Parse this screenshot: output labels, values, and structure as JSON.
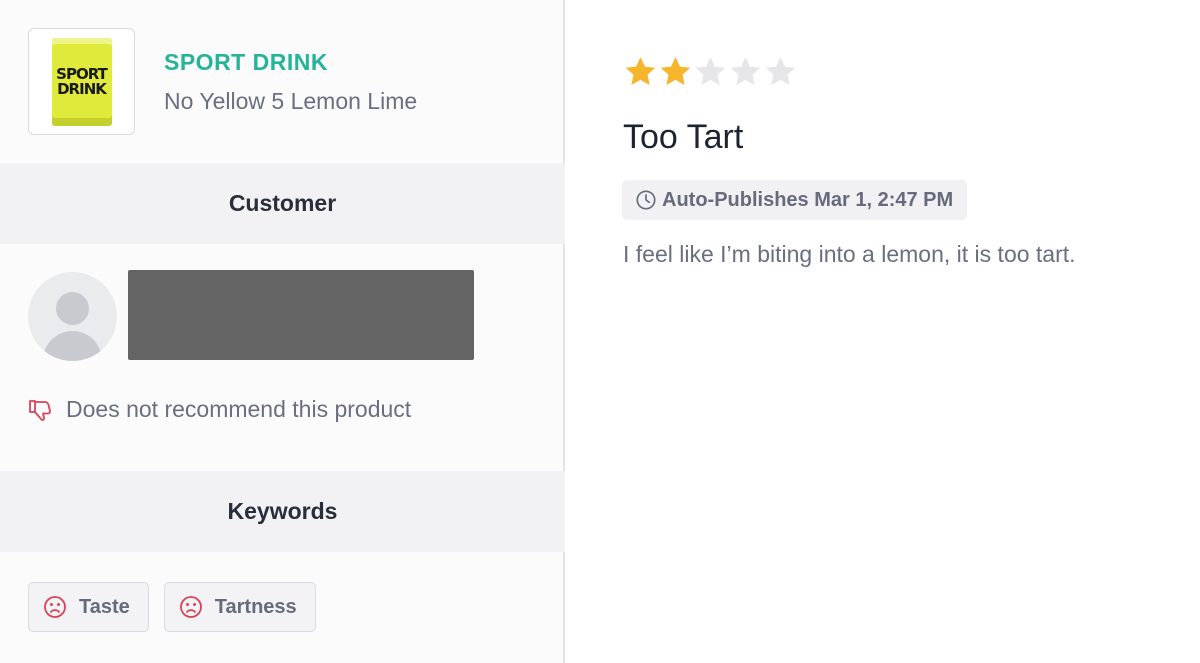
{
  "product": {
    "brand": "SPORT DRINK",
    "name": "No Yellow 5 Lemon Lime",
    "can_text_line1": "SPORT",
    "can_text_line2": "DRINK"
  },
  "customer": {
    "section_title": "Customer",
    "recommendation": "Does not recommend this product"
  },
  "keywords": {
    "section_title": "Keywords",
    "items": [
      {
        "label": "Taste",
        "icon": "frown-icon"
      },
      {
        "label": "Tartness",
        "icon": "frown-icon"
      }
    ]
  },
  "review": {
    "rating": 2,
    "max_rating": 5,
    "title": "Too Tart",
    "publish_status": "Auto-Publishes Mar 1, 2:47 PM",
    "body": "I feel like I’m biting into a lemon, it is too tart."
  },
  "colors": {
    "brand": "#25b39a",
    "star_filled": "#f7b52c",
    "star_empty": "#e6e6e9",
    "negative": "#d9435a",
    "redacted": "#646464"
  }
}
